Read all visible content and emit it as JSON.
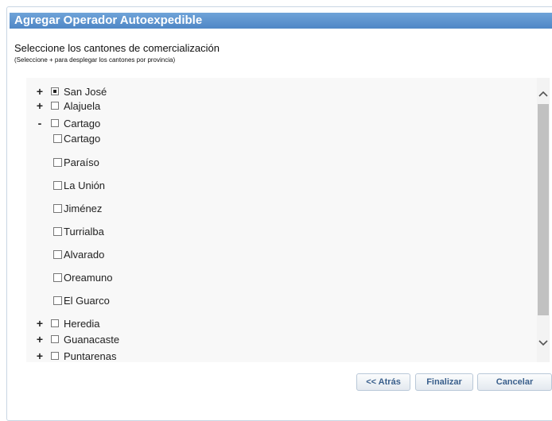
{
  "dialog": {
    "title": "Agregar Operador Autoexpedible"
  },
  "instructions": {
    "main": "Seleccione los cantones de comercialización",
    "hint": "(Seleccione + para desplegar los cantones por provincia)"
  },
  "tree": {
    "provinces": [
      {
        "toggle": "+",
        "name": "San José",
        "state": "partial"
      },
      {
        "toggle": "+",
        "name": "Alajuela",
        "state": "unchecked"
      },
      {
        "toggle": "-",
        "name": "Cartago",
        "state": "unchecked"
      },
      {
        "toggle": "+",
        "name": "Heredia",
        "state": "unchecked"
      },
      {
        "toggle": "+",
        "name": "Guanacaste",
        "state": "unchecked"
      },
      {
        "toggle": "+",
        "name": "Puntarenas",
        "state": "unchecked"
      }
    ],
    "cartago_cantons": [
      "Cartago",
      "Paraíso",
      "La Unión",
      "Jiménez",
      "Turrialba",
      "Alvarado",
      "Oreamuno",
      "El Guarco"
    ]
  },
  "scrollbar": {
    "up_icon": "chevron-up-icon",
    "down_icon": "chevron-down-icon"
  },
  "buttons": {
    "back": "<< Atrás",
    "finish": "Finalizar",
    "cancel": "Cancelar"
  }
}
